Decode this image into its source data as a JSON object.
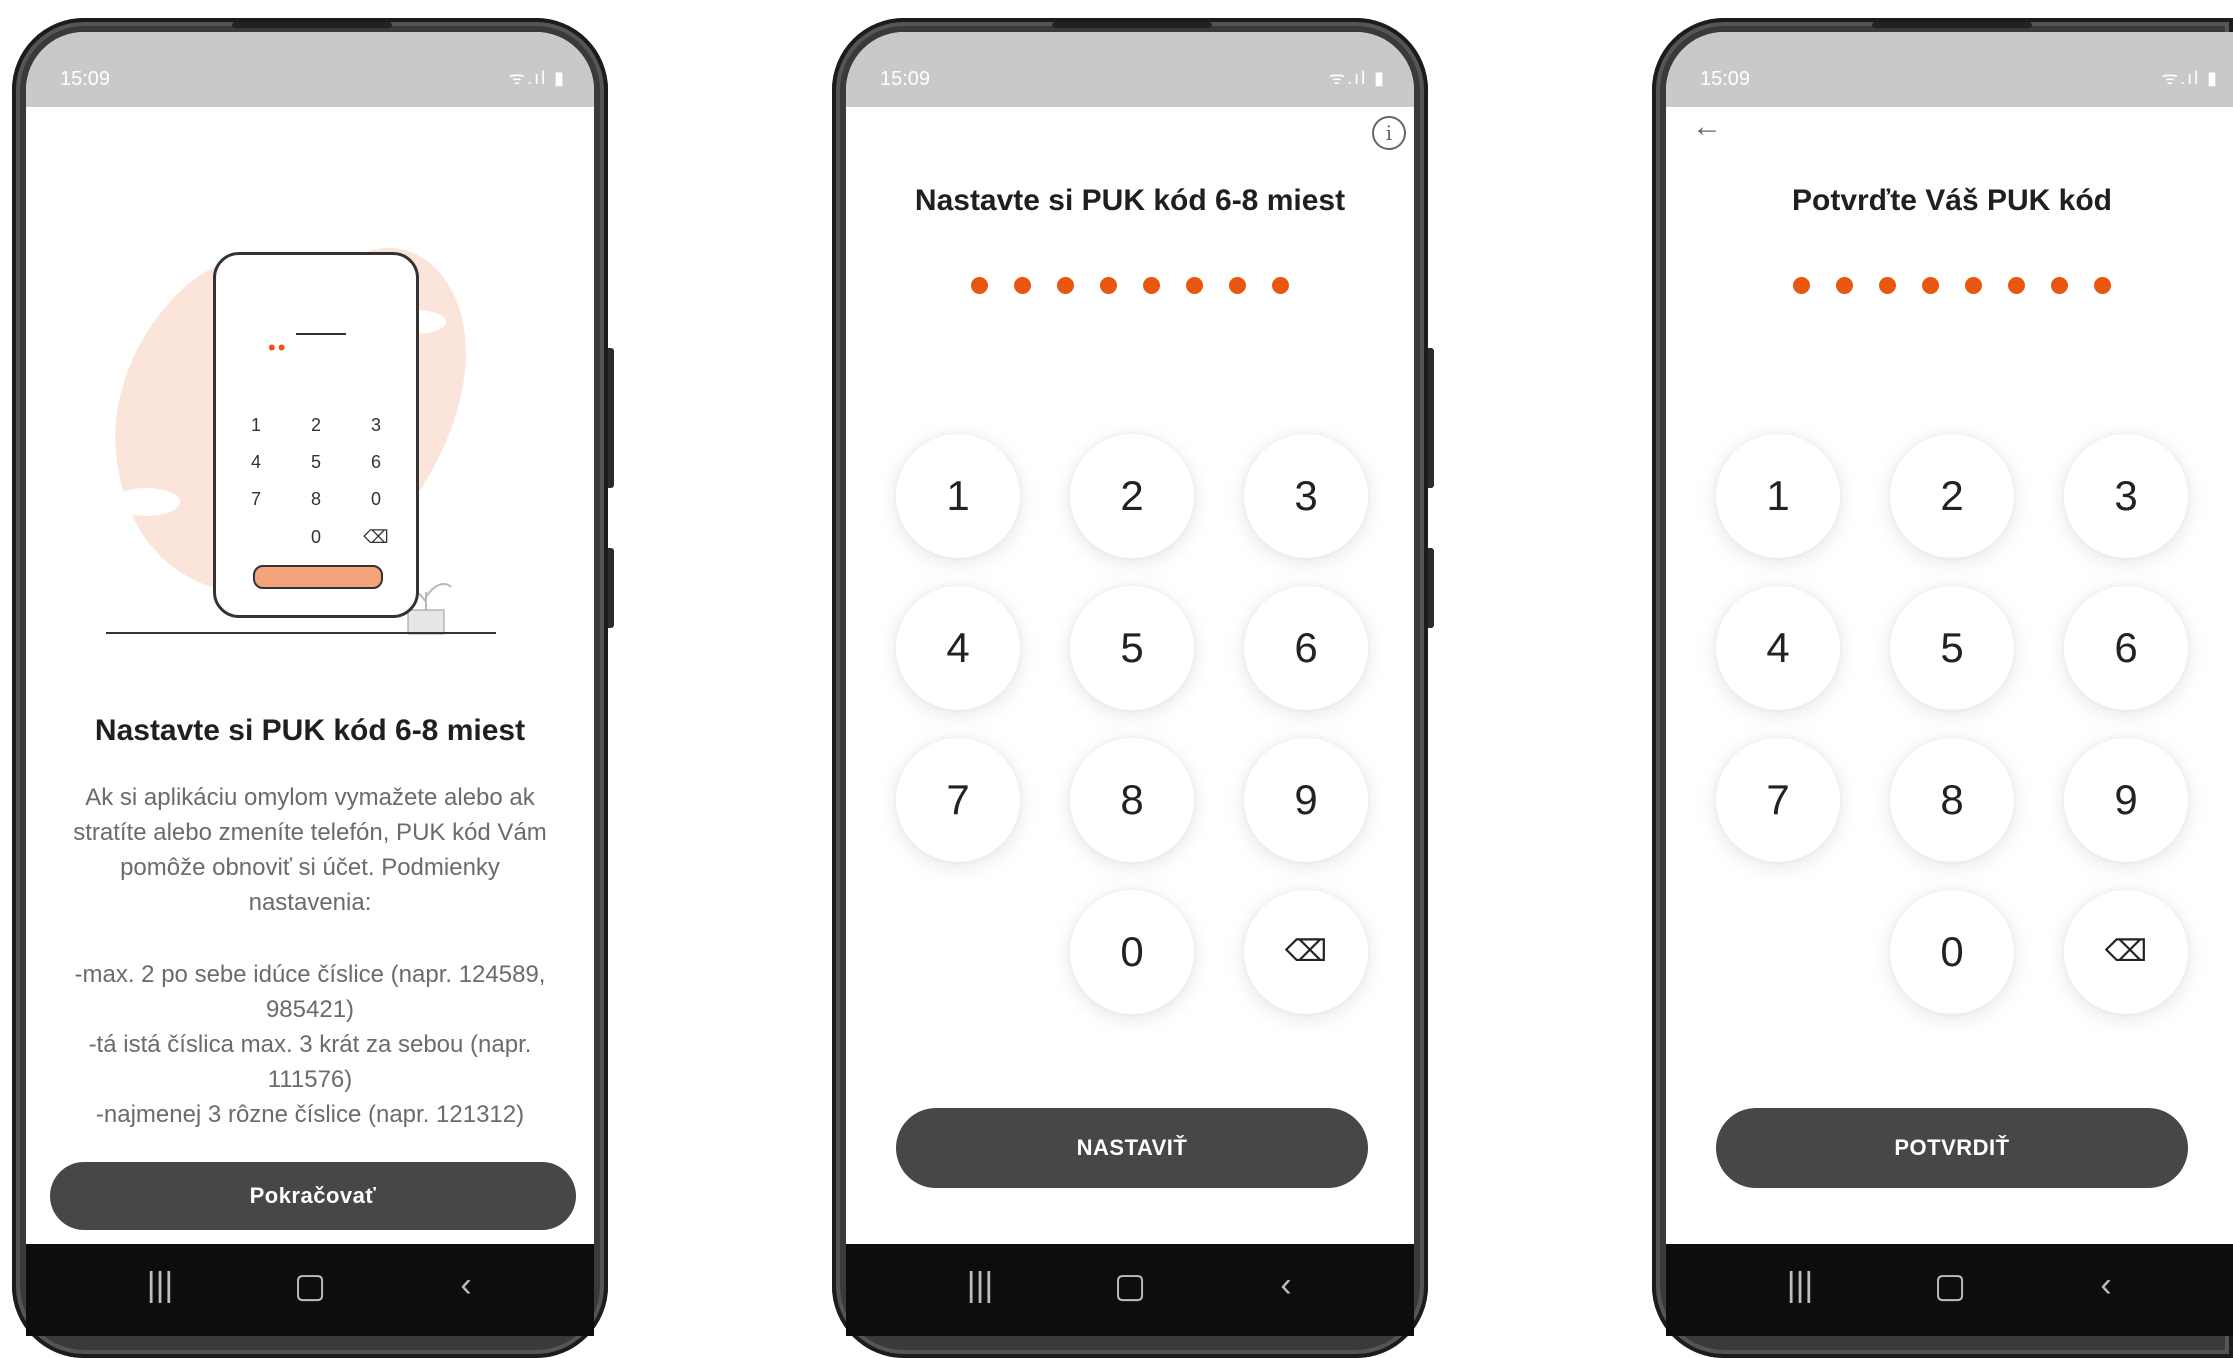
{
  "status": {
    "time": "15:09",
    "icons_text": "ᯤ.ıl ▮"
  },
  "screen1": {
    "title": "Nastavte si PUK kód 6-8 miest",
    "desc_lines": [
      "Ak si aplikáciu omylom vymažete alebo ak",
      "stratíte alebo zmeníte telefón, PUK kód Vám",
      "pomôže obnoviť si účet. Podmienky",
      "nastavenia:"
    ],
    "rules_lines": [
      "-max. 2 po sebe idúce číslice (napr. 124589,",
      "985421)",
      "-tá istá číslica max. 3 krát za sebou (napr.",
      "111576)",
      "-najmenej 3 rôzne číslice (napr. 121312)"
    ],
    "button": "Pokračovať",
    "illustration_keys": [
      "1",
      "2",
      "3",
      "4",
      "5",
      "6",
      "7",
      "8",
      "0",
      "0"
    ],
    "illustration_back_icon": "⌫",
    "illustration_dots": "••"
  },
  "screen2": {
    "title": "Nastavte si PUK kód 6-8 miest",
    "info_icon": "i",
    "button": "NASTAVIŤ"
  },
  "screen3": {
    "title": "Potvrďte Váš PUK kód",
    "back_icon": "←",
    "button": "POTVRDIŤ"
  },
  "keypad": {
    "keys": [
      "1",
      "2",
      "3",
      "4",
      "5",
      "6",
      "7",
      "8",
      "9",
      "0"
    ],
    "backspace_icon": "⌫"
  },
  "navbar": {
    "recents": "|||",
    "home": "▢",
    "back": "‹"
  },
  "colors": {
    "accent": "#e8560f",
    "button": "#474747",
    "status": "#c9c9c9"
  }
}
